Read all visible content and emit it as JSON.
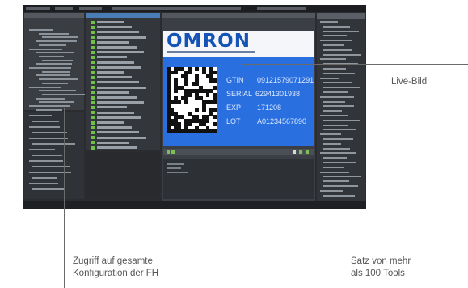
{
  "screenshot": {
    "brand_logo": "OMRON",
    "code_fields": [
      {
        "key": "GTIN",
        "value": "09121579071291"
      },
      {
        "key": "SERIAL",
        "value": "62941301938"
      },
      {
        "key": "EXP",
        "value": "171208"
      },
      {
        "key": "LOT",
        "value": "A01234567890"
      }
    ],
    "colors": {
      "image_blue": "#2a6fe0",
      "logo_blue": "#1553b6",
      "frame": "#2a2c30"
    }
  },
  "callouts": {
    "live_image": "Live-Bild",
    "config_access": [
      "Zugriff auf gesamte",
      "Konfiguration der FH"
    ],
    "tool_set": [
      "Satz von mehr",
      "als 100 Tools"
    ]
  }
}
